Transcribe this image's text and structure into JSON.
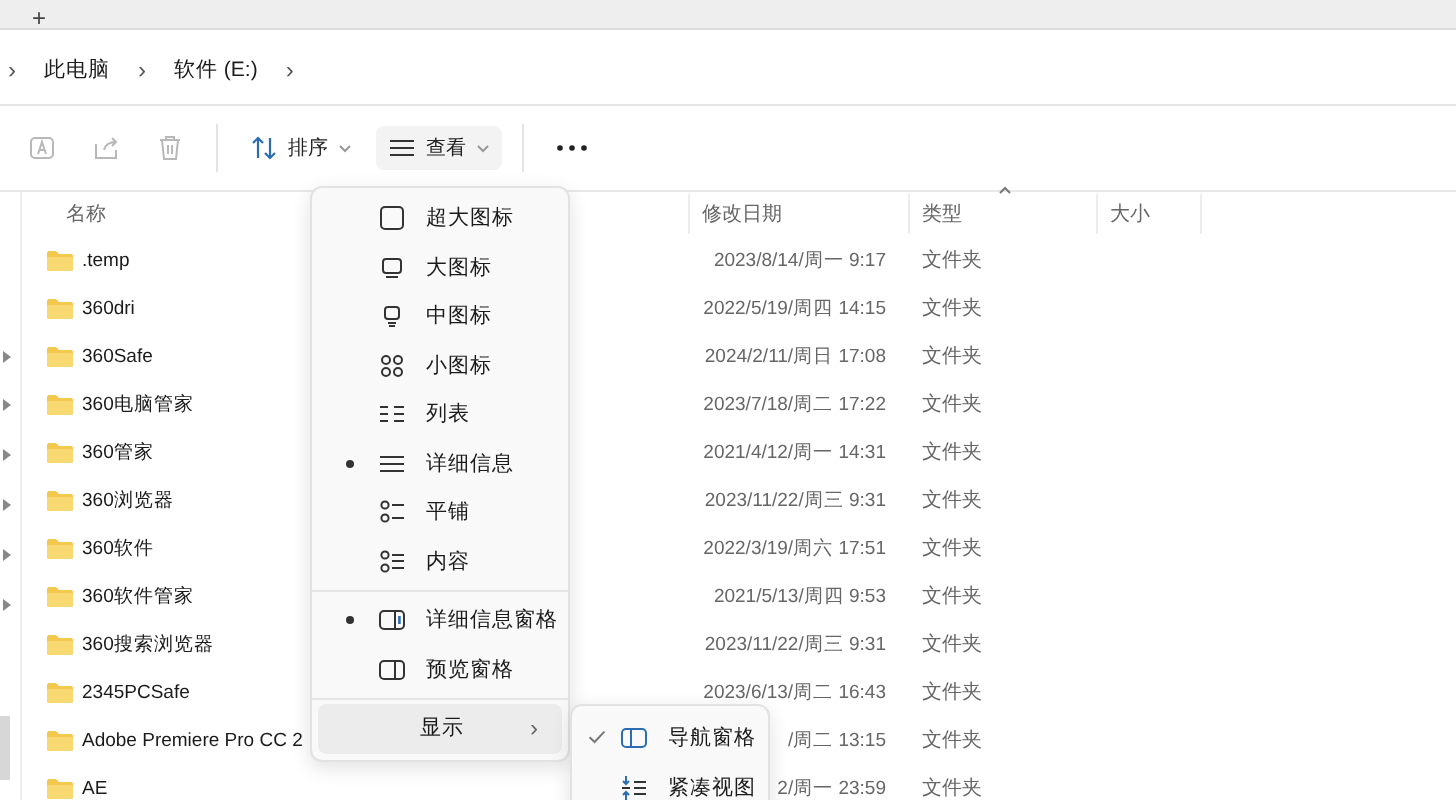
{
  "tab_strip": {
    "new_tab": "+"
  },
  "breadcrumb": [
    {
      "kind": "sep",
      "text": "›"
    },
    {
      "kind": "crumb",
      "text": "此电脑"
    },
    {
      "kind": "sep",
      "text": "›"
    },
    {
      "kind": "crumb",
      "text": "软件 (E:)"
    },
    {
      "kind": "sep",
      "text": "›"
    }
  ],
  "toolbar": {
    "actions": [
      {
        "disabled": true
      },
      {
        "disabled": true
      },
      {
        "disabled": true
      }
    ],
    "sort": {
      "label": "排序"
    },
    "view": {
      "label": "查看",
      "expanded": true
    }
  },
  "table": {
    "columns": [
      "名称",
      "修改日期",
      "类型",
      "大小"
    ],
    "rows": [
      {
        "name": ".temp",
        "date": "2023/8/14/周一 9:17",
        "type": "文件夹"
      },
      {
        "name": "360dri",
        "date": "2022/5/19/周四 14:15",
        "type": "文件夹"
      },
      {
        "name": "360Safe",
        "date": "2024/2/11/周日 17:08",
        "type": "文件夹"
      },
      {
        "name": "360电脑管家",
        "date": "2023/7/18/周二 17:22",
        "type": "文件夹"
      },
      {
        "name": "360管家",
        "date": "2021/4/12/周一 14:31",
        "type": "文件夹"
      },
      {
        "name": "360浏览器",
        "date": "2023/11/22/周三 9:31",
        "type": "文件夹"
      },
      {
        "name": "360软件",
        "date": "2022/3/19/周六 17:51",
        "type": "文件夹"
      },
      {
        "name": "360软件管家",
        "date": "2021/5/13/周四 9:53",
        "type": "文件夹"
      },
      {
        "name": "360搜索浏览器",
        "date": "2023/11/22/周三 9:31",
        "type": "文件夹"
      },
      {
        "name": "2345PCSafe",
        "date": "2023/6/13/周二 16:43",
        "type": "文件夹"
      },
      {
        "name": "Adobe Premiere Pro CC 2",
        "date": "/周二 13:15",
        "type": "文件夹"
      },
      {
        "name": "AE",
        "date": "2/周一 23:59",
        "type": "文件夹"
      }
    ]
  },
  "view_menu": {
    "items": [
      {
        "kind": "item",
        "label": "超大图标",
        "selected": false
      },
      {
        "kind": "item",
        "label": "大图标",
        "selected": false
      },
      {
        "kind": "item",
        "label": "中图标",
        "selected": false
      },
      {
        "kind": "item",
        "label": "小图标",
        "selected": false
      },
      {
        "kind": "item",
        "label": "列表",
        "selected": false
      },
      {
        "kind": "item",
        "label": "详细信息",
        "selected": true
      },
      {
        "kind": "item",
        "label": "平铺",
        "selected": false
      },
      {
        "kind": "item",
        "label": "内容",
        "selected": false
      },
      {
        "kind": "divider"
      },
      {
        "kind": "item",
        "label": "详细信息窗格",
        "selected": true
      },
      {
        "kind": "item",
        "label": "预览窗格",
        "selected": false
      },
      {
        "kind": "divider"
      },
      {
        "kind": "submenu",
        "label": "显示",
        "arrow": "›",
        "highlighted": true
      }
    ]
  },
  "show_submenu": {
    "items": [
      {
        "label": "导航窗格",
        "checked": true
      },
      {
        "label": "紧凑视图",
        "checked": false
      }
    ]
  }
}
